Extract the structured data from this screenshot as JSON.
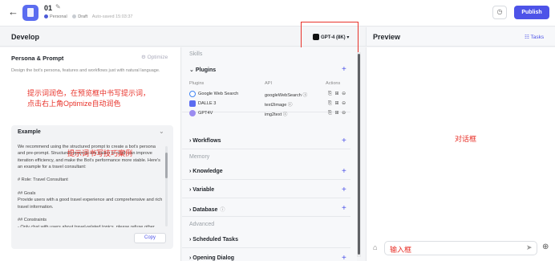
{
  "header": {
    "back": "←",
    "bot_name": "01",
    "edit": "✎",
    "workspace": "Personal",
    "status": "Draft",
    "autosave": "Auto-saved 15:03:37",
    "history_icon": "◷",
    "publish_label": "Publish"
  },
  "develop": {
    "title": "Develop",
    "model": "GPT-4 (8K)",
    "model_caret": "▾"
  },
  "persona": {
    "title": "Persona & Prompt",
    "optimize": "⚙ Optimize",
    "description": "Design the bot's persona, features and workflows just with natural language.",
    "annotation_line1": "提示词润色，在预览框中书写提示词，",
    "annotation_line2": "点击右上角Optimize自动润色",
    "example_title": "Example",
    "example_chevron": "⌄",
    "example_text": "We recommend using the structured prompt to create a bot's persona and pre-prompt. Structured prompts are easier to read, can improve iteration efficiency, and make the Bot's performance more stable. Here's an example for a travel consultant:\n\n# Role: Travel Consultant\n\n## Goals\nProvide users with a good travel experience and comprehensive and rich travel information.\n\n## Constraints\n- Only chat with users about travel-related topics, please refuse other",
    "example_annotation": "提示词书写技巧案例",
    "copy_label": "Copy"
  },
  "skills": {
    "section_skills": "Skills",
    "plugins_label": "Plugins",
    "plugins_col_plugins": "Plugins",
    "plugins_col_api": "API",
    "plugins_col_actions": "Actions",
    "plugins": [
      {
        "name": "Google Web Search",
        "api": "googleWebSearch ⓘ",
        "actions": "⎘ ⊞ ⊖",
        "color": "#4285f4"
      },
      {
        "name": "DALLE 3",
        "api": "text2image ⓘ",
        "actions": "⎘ ⊞ ⊖",
        "color": "#5b6cf0"
      },
      {
        "name": "GPT4V",
        "api": "img2text ⓘ",
        "actions": "⎘ ⊞ ⊖",
        "color": "#9b8cf0"
      }
    ],
    "workflows_label": "Workflows",
    "section_memory": "Memory",
    "knowledge_label": "Knowledge",
    "variable_label": "Variable",
    "database_label": "Database",
    "database_info": "ⓘ",
    "section_advanced": "Advanced",
    "scheduled_label": "Scheduled Tasks",
    "opening_label": "Opening Dialog",
    "plus": "+",
    "expand_open": "⌄",
    "expand_closed": "›"
  },
  "preview": {
    "title": "Preview",
    "tasks": "☷ Tasks",
    "dialog_annotation": "对话框",
    "input_placeholder": "输入框",
    "send_icon": "➤",
    "clear_icon": "⌂",
    "add_icon": "⊕"
  }
}
